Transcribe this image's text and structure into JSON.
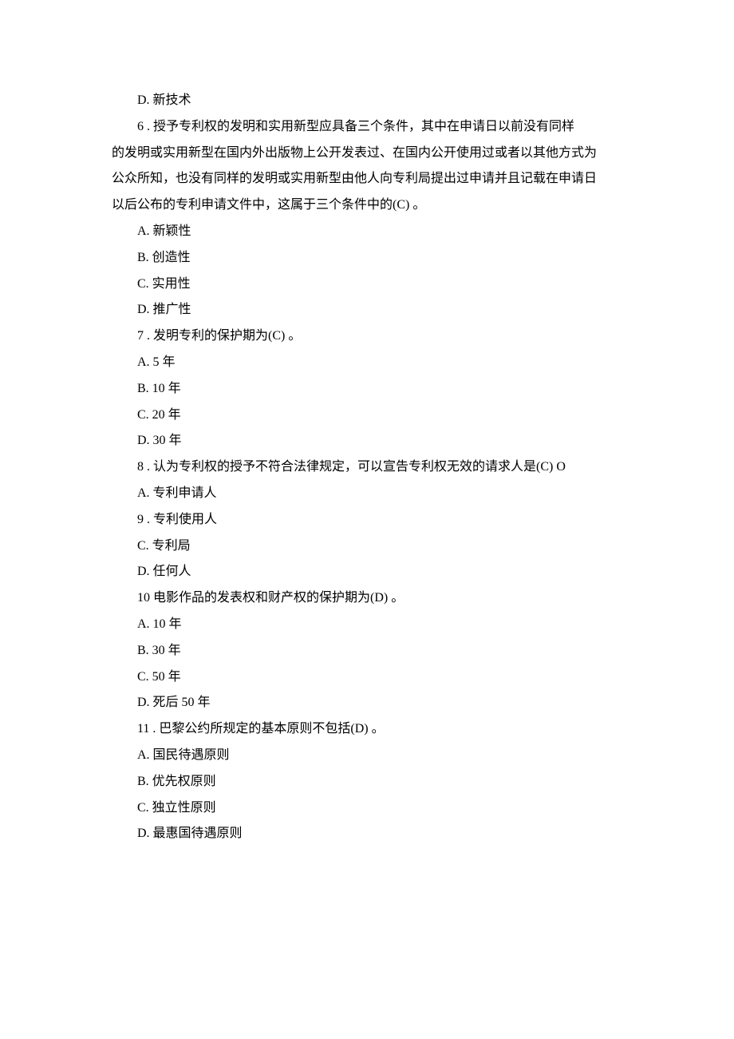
{
  "lines": [
    {
      "cls": "option",
      "text": "D. 新技术"
    },
    {
      "cls": "question",
      "text": "6 . 授予专利权的发明和实用新型应具备三个条件，其中在申请日以前没有同样"
    },
    {
      "cls": "no-indent-flush",
      "text": "的发明或实用新型在国内外出版物上公开发表过、在国内公开使用过或者以其他方式为"
    },
    {
      "cls": "no-indent-flush",
      "text": "公众所知，也没有同样的发明或实用新型由他人向专利局提出过申请并且记载在申请日"
    },
    {
      "cls": "no-indent-flush",
      "text": "以后公布的专利申请文件中，这属于三个条件中的(C) 。"
    },
    {
      "cls": "option",
      "text": "A. 新颖性"
    },
    {
      "cls": "option",
      "text": "B. 创造性"
    },
    {
      "cls": "option",
      "text": "C. 实用性"
    },
    {
      "cls": "option",
      "text": "D. 推广性"
    },
    {
      "cls": "question",
      "text": "7 . 发明专利的保护期为(C) 。"
    },
    {
      "cls": "option",
      "text": "A. 5 年"
    },
    {
      "cls": "option",
      "text": "B.  10 年"
    },
    {
      "cls": "option",
      "text": "C.  20 年"
    },
    {
      "cls": "option",
      "text": "D.  30 年"
    },
    {
      "cls": "question",
      "text": "8 . 认为专利权的授予不符合法律规定，可以宣告专利权无效的请求人是(C) O"
    },
    {
      "cls": "option",
      "text": "A. 专利申请人"
    },
    {
      "cls": "question",
      "text": "9 . 专利使用人"
    },
    {
      "cls": "option",
      "text": "C. 专利局"
    },
    {
      "cls": "option",
      "text": "D. 任何人"
    },
    {
      "cls": "question",
      "text": "10  电影作品的发表权和财产权的保护期为(D) 。"
    },
    {
      "cls": "option",
      "text": "A.  10 年"
    },
    {
      "cls": "option",
      "text": "B.  30 年"
    },
    {
      "cls": "option",
      "text": "C.  50 年"
    },
    {
      "cls": "option",
      "text": "D. 死后 50 年"
    },
    {
      "cls": "question",
      "text": "11 . 巴黎公约所规定的基本原则不包括(D) 。"
    },
    {
      "cls": "option",
      "text": "A. 国民待遇原则"
    },
    {
      "cls": "option",
      "text": "B. 优先权原则"
    },
    {
      "cls": "option",
      "text": "C. 独立性原则"
    },
    {
      "cls": "option",
      "text": "D. 最惠国待遇原则"
    }
  ]
}
